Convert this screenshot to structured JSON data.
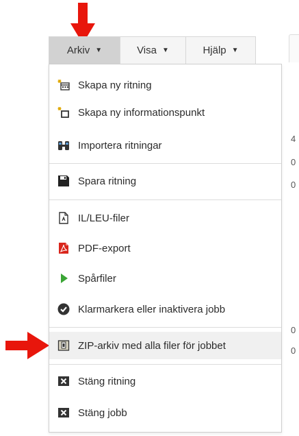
{
  "menubar": {
    "tabs": [
      {
        "label": "Arkiv",
        "caret": "▼",
        "active": true
      },
      {
        "label": "Visa",
        "caret": "▼",
        "active": false
      },
      {
        "label": "Hjälp",
        "caret": "▼",
        "active": false
      }
    ]
  },
  "dropdown": {
    "items": [
      {
        "label": "Skapa ny ritning",
        "icon": "new-drawing-icon"
      },
      {
        "label": "Skapa ny informationspunkt",
        "icon": "new-infopoint-icon"
      },
      {
        "label": "Importera ritningar",
        "icon": "import-icon"
      },
      {
        "label": "Spara ritning",
        "icon": "save-icon"
      },
      {
        "label": "IL/LEU-filer",
        "icon": "document-icon"
      },
      {
        "label": "PDF-export",
        "icon": "pdf-icon"
      },
      {
        "label": "Spårfiler",
        "icon": "play-icon"
      },
      {
        "label": "Klarmarkera eller inaktivera jobb",
        "icon": "check-circle-icon"
      },
      {
        "label": "ZIP-arkiv med alla filer för jobbet",
        "icon": "zip-archive-icon"
      },
      {
        "label": "Stäng ritning",
        "icon": "close-box-icon"
      },
      {
        "label": "Stäng jobb",
        "icon": "close-box-icon"
      }
    ]
  },
  "background": {
    "fragments": [
      "4",
      "0",
      "0",
      "0",
      "0"
    ]
  },
  "colors": {
    "annotation_red": "#e8160c",
    "menubar_bg": "#f5f5f5",
    "active_tab_bg": "#d2d2d2",
    "highlight_row": "#f0f0f0",
    "pdf_red": "#d9261c",
    "play_green": "#3aa535"
  }
}
